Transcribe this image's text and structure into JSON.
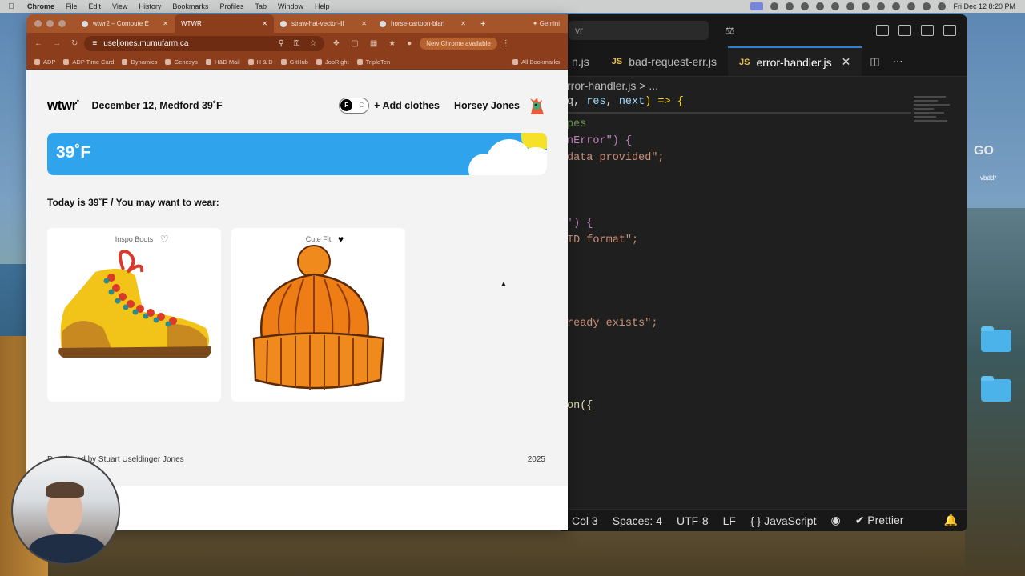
{
  "menubar": {
    "items": [
      "Chrome",
      "File",
      "Edit",
      "View",
      "History",
      "Bookmarks",
      "Profiles",
      "Tab",
      "Window",
      "Help"
    ],
    "clock": "Fri Dec 12  8:20 PM"
  },
  "browser": {
    "tabs": [
      {
        "label": "wtwr2 – Compute E",
        "active": false
      },
      {
        "label": "WTWR",
        "active": true
      },
      {
        "label": "straw-hat-vector-ill",
        "active": false
      },
      {
        "label": "horse-cartoon-blan",
        "active": false
      }
    ],
    "new_tab": "+",
    "gemini": "✦ Gemini",
    "url": "useljones.mumufarm.ca",
    "update_notice": "New Chrome available",
    "bookmarks": [
      "ADP",
      "ADP Time Card",
      "Dynamics",
      "Genesys",
      "H&D Mail",
      "H & D",
      "GitHub",
      "JobRight",
      "TripleTen"
    ],
    "all_bookmarks": "All Bookmarks"
  },
  "app": {
    "logo": "wtwr",
    "logo_degree": "°",
    "date_location": "December 12, Medford 39˚F",
    "toggle_on": "F",
    "toggle_off": "C",
    "add_clothes": "+ Add clothes",
    "username": "Horsey Jones",
    "banner_temp": "39˚F",
    "today_text": "Today is 39˚F / You may want to wear:",
    "cards": [
      {
        "name": "Inspo Boots",
        "liked": false
      },
      {
        "name": "Cute Fit",
        "liked": true
      }
    ],
    "footer_by": "Developed by Stuart Useldinger Jones",
    "footer_year": "2025"
  },
  "editor": {
    "search": "vr",
    "tabs": [
      {
        "label": "n.js",
        "active": false
      },
      {
        "label": "bad-request-err.js",
        "active": false
      },
      {
        "label": "error-handler.js",
        "active": true
      }
    ],
    "breadcrumb": "rror-handler.js > ...",
    "code": [
      {
        "a": "q, ",
        "b": "res",
        "c": ", ",
        "d": "next",
        "e": ") => {"
      },
      {
        "a": "pes"
      },
      {
        "a": "nError\") {"
      },
      {
        "a": "data provided\";"
      },
      {
        "a": "') {"
      },
      {
        "a": "ID format\";"
      },
      {
        "a": "ready exists\";"
      },
      {
        "a": "on({"
      }
    ],
    "status": {
      "col": "Col 3",
      "spaces": "Spaces: 4",
      "encoding": "UTF-8",
      "eol": "LF",
      "language": "{ } JavaScript",
      "prettier": "✔ Prettier"
    }
  },
  "desktop": {
    "label_go": "GO",
    "label_vbdd": "vbdd*"
  }
}
